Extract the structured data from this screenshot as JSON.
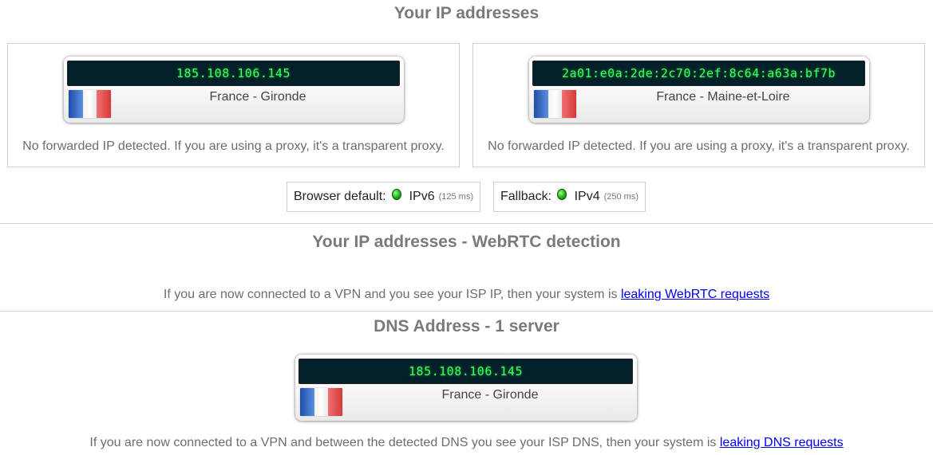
{
  "ip_section": {
    "title": "Your IP addresses",
    "panels": [
      {
        "ip": "185.108.106.145",
        "location": "France - Gironde",
        "note": "No forwarded IP detected. If you are using a proxy, it's a transparent proxy."
      },
      {
        "ip": "2a01:e0a:2de:2c70:2ef:8c64:a63a:bf7b",
        "location": "France - Maine-et-Loire",
        "note": "No forwarded IP detected. If you are using a proxy, it's a transparent proxy."
      }
    ],
    "browser_default": {
      "label": "Browser default:",
      "protocol": "IPv6",
      "latency": "(125 ms)",
      "status_color": "#2fc72a"
    },
    "fallback": {
      "label": "Fallback:",
      "protocol": "IPv4",
      "latency": "(250 ms)",
      "status_color": "#2fc72a"
    }
  },
  "webrtc_section": {
    "title": "Your IP addresses - WebRTC detection",
    "info_text": "If you are now connected to a VPN and you see your ISP IP, then your system is",
    "link_text": "leaking WebRTC requests"
  },
  "dns_section": {
    "title": "DNS Address - 1 server",
    "server": {
      "ip": "185.108.106.145",
      "location": "France - Gironde"
    },
    "info_text": "If you are now connected to a VPN and between the detected DNS you see your ISP DNS, then your system is",
    "link_text": "leaking DNS requests"
  },
  "colors": {
    "display_bg": "#04202a",
    "display_text": "#3cff5a",
    "link": "#0000ee",
    "title": "#7a7a7a"
  },
  "icons": {
    "flag": "france-flag-icon",
    "status": "green-led-icon"
  }
}
